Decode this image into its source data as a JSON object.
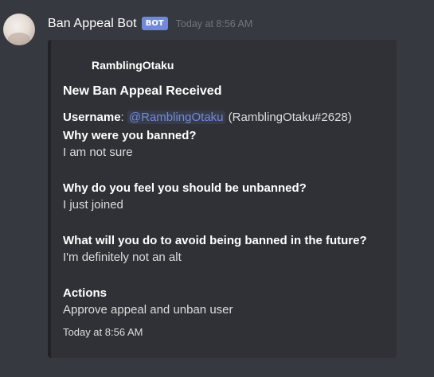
{
  "message": {
    "author": "Ban Appeal Bot",
    "bot_tag": "BOT",
    "timestamp": "Today at 8:56 AM"
  },
  "embed": {
    "author_name": "RamblingOtaku",
    "title": "New Ban Appeal Received",
    "username_label": "Username",
    "username_separator": ":",
    "username_mention": "@RamblingOtaku",
    "username_tag": "(RamblingOtaku#2628)",
    "fields": [
      {
        "name": "Why were you banned?",
        "value": "I am not sure"
      },
      {
        "name": "Why do you feel you should be unbanned?",
        "value": "I just joined"
      },
      {
        "name": "What will you do to avoid being banned in the future?",
        "value": "I'm definitely not an alt"
      }
    ],
    "actions_label": "Actions",
    "action_link": "Approve appeal and unban user",
    "footer": "Today at 8:56 AM"
  },
  "colors": {
    "background": "#36393f",
    "embed_bg": "#2f3136",
    "bot_tag": "#7289da",
    "link": "#00b0f4",
    "mention": "#7289da"
  }
}
